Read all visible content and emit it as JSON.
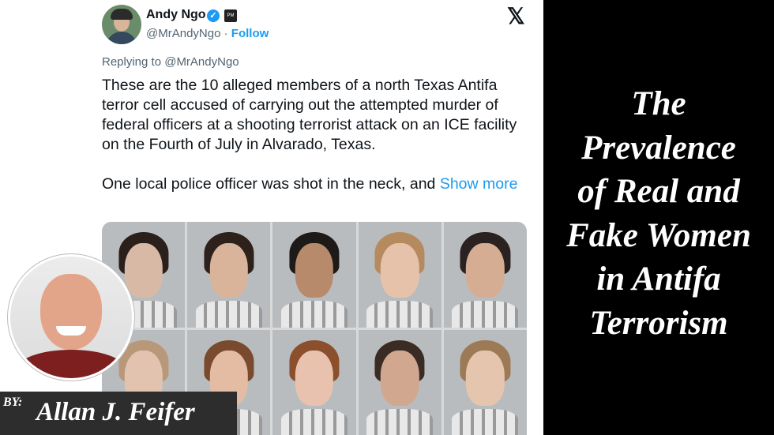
{
  "tweet": {
    "author_name": "Andy Ngo",
    "verified_icon": "✓",
    "affiliation_badge": "PM",
    "handle": "@MrAndyNgo",
    "separator": "·",
    "follow_label": "Follow",
    "x_logo": "𝕏",
    "replying_to": "Replying to @MrAndyNgo",
    "paragraph1": "These are the 10 alleged members of a north Texas Antifa terror cell accused of carrying out the attempted murder of federal officers at a shooting terrorist attack on an ICE facility on the Fourth of July in Alvarado, Texas.",
    "paragraph2": "One local police officer was shot in the neck, and",
    "show_more": "Show more"
  },
  "byline": {
    "by_label": "BY:",
    "author": "Allan J. Feifer"
  },
  "title": {
    "lines": [
      "The",
      "Prevalence",
      "of Real and",
      "Fake Women",
      "in Antifa",
      "Terrorism"
    ]
  },
  "colors": {
    "accent": "#1d9bf0",
    "panel_bg": "#000000",
    "byline_bg": "#2d2d2d"
  },
  "mugshots": [
    {
      "skin": "#d8b9a6",
      "hair": "#2a1f1a"
    },
    {
      "skin": "#d9b49a",
      "hair": "#2e211b"
    },
    {
      "skin": "#b88a6c",
      "hair": "#1d1a18"
    },
    {
      "skin": "#e7c2ab",
      "hair": "#b58a5f"
    },
    {
      "skin": "#d5ad92",
      "hair": "#2a2220"
    },
    {
      "skin": "#e2c3b0",
      "hair": "#b99879"
    },
    {
      "skin": "#e3bca3",
      "hair": "#7a4a2e"
    },
    {
      "skin": "#e8c2ae",
      "hair": "#8b4f2c"
    },
    {
      "skin": "#d1a88f",
      "hair": "#3a2c24"
    },
    {
      "skin": "#e5c5ad",
      "hair": "#9b7a55"
    }
  ]
}
